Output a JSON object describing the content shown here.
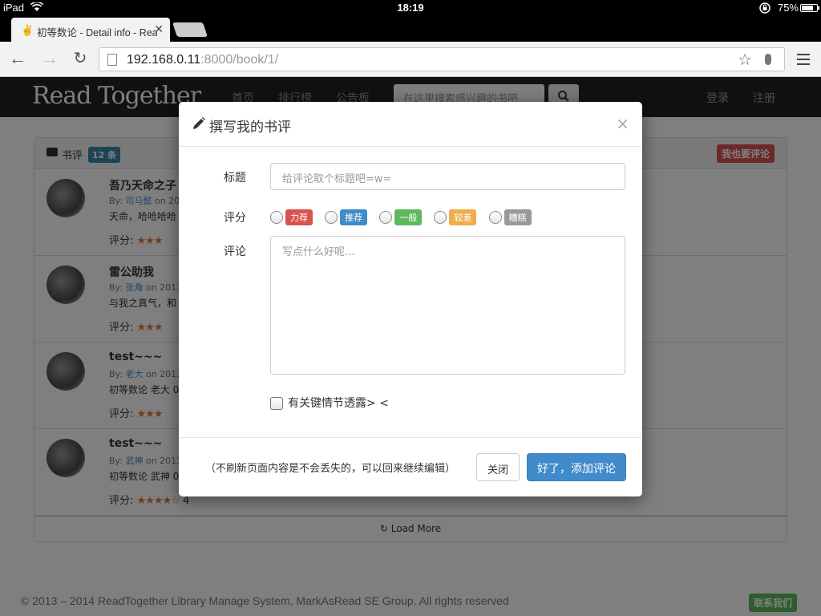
{
  "statusbar": {
    "device": "iPad",
    "time": "18:19",
    "battery": "75%"
  },
  "browser": {
    "tab_title": "初等数论 - Detail info - Rea",
    "url_host": "192.168.0.11",
    "url_rest": ":8000/book/1/"
  },
  "site": {
    "brand": "Read Together",
    "nav": [
      "首页",
      "排行榜",
      "公告板"
    ],
    "search_placeholder": "在这里搜索感兴趣的书吧",
    "login": "登录",
    "register": "注册"
  },
  "reviews": {
    "heading": "书评",
    "count_badge": "12 条",
    "add_button": "我也要评论",
    "load_more": "Load More",
    "items": [
      {
        "title": "吾乃天命之子",
        "by": "By: ",
        "author": "司马懿",
        "date": " on 201",
        "body": "天命，哈哈哈哈",
        "rating_label": "评分:",
        "stars": "★★★",
        "score": ""
      },
      {
        "title": "雷公助我",
        "by": "By: ",
        "author": "张角",
        "date": " on 2013",
        "body": "与我之真气，和",
        "rating_label": "评分:",
        "stars": "★★★",
        "score": ""
      },
      {
        "title": "test~~~",
        "by": "By: ",
        "author": "老大",
        "date": " on 2013",
        "body": "初等数论 老大 0.",
        "rating_label": "评分:",
        "stars": "★★★",
        "score": ""
      },
      {
        "title": "test~~~",
        "by": "By: ",
        "author": "武神",
        "date": " on 2013",
        "body": "初等数论 武神 0",
        "rating_label": "评分:",
        "stars": "★★★★☆",
        "score": "4"
      }
    ]
  },
  "footer": {
    "copyright": "© 2013 – 2014 ReadTogether Library Manage System, MarkAsRead SE Group. All rights reserved",
    "contact": "联系我们"
  },
  "modal": {
    "title": "撰写我的书评",
    "close_symbol": "×",
    "title_label": "标题",
    "title_placeholder": "给评论取个标题吧=w=",
    "rating_label": "评分",
    "ratings": [
      {
        "label": "力荐",
        "color": "#d9534f"
      },
      {
        "label": "推荐",
        "color": "#428bca"
      },
      {
        "label": "一般",
        "color": "#5cb85c"
      },
      {
        "label": "较差",
        "color": "#f0ad4e"
      },
      {
        "label": "糟糕",
        "color": "#999999"
      }
    ],
    "comment_label": "评论",
    "comment_placeholder": "写点什么好呢...",
    "spoiler_label": "有关键情节透露> <",
    "footer_hint": "（不刷新页面内容是不会丢失的，可以回来继续编辑）",
    "close_button": "关闭",
    "submit_button": "好了，添加评论"
  }
}
